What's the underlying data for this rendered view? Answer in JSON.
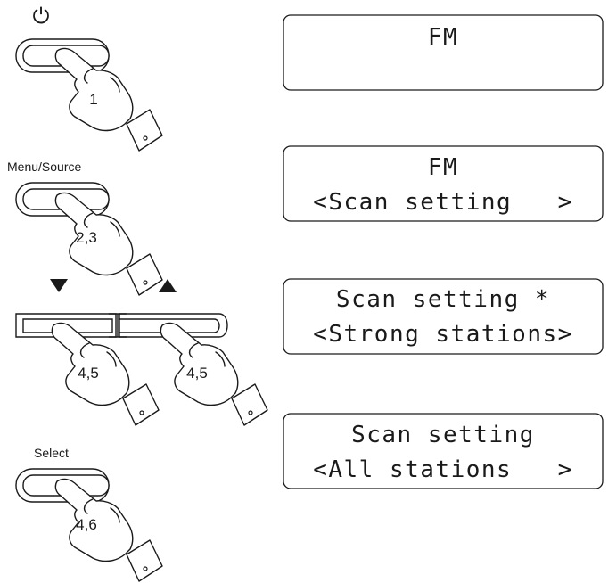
{
  "labels": {
    "power_symbol": "⏻",
    "menu_source": "Menu/Source",
    "select": "Select"
  },
  "steps": {
    "power": "1",
    "menu": "2,3",
    "down": "4,5",
    "up": "4,5",
    "select": "4,6"
  },
  "displays": [
    {
      "line1": "FM",
      "line2": ""
    },
    {
      "line1": "FM",
      "line2": "<Scan setting   >"
    },
    {
      "line1": "Scan setting *",
      "line2": "<Strong stations>"
    },
    {
      "line1": "Scan setting",
      "line2": "<All stations   >"
    }
  ],
  "icons": {
    "down_arrow": "down-triangle-icon",
    "up_arrow": "up-triangle-icon",
    "pressing_hand": "pressing-hand-icon"
  }
}
